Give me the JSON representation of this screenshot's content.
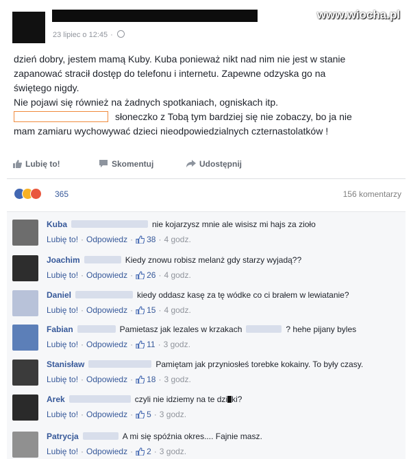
{
  "watermark": "www.wiocha.pl",
  "post": {
    "timestamp": "23 lipiec o 12:45",
    "lines": [
      "dzień dobry, jestem mamą Kuby. Kuba ponieważ nikt nad nim nie jest w stanie",
      "zapanować stracił dostęp do telefonu i internetu. Zapewne odzyska go na",
      "świętego nigdy.",
      "Nie pojawi się również na żadnych spotkaniach, ogniskach itp.",
      "słoneczko z Tobą tym bardziej się nie zobaczy, bo ja nie",
      "mam zamiaru wychowywać dzieci nieodpowiedzialnych czternastolatków !"
    ]
  },
  "actions": {
    "like": "Lubię to!",
    "comment": "Skomentuj",
    "share": "Udostępnij"
  },
  "reactions": {
    "count": "365",
    "comments": "156 komentarzy",
    "icons": [
      "like-reaction-icon",
      "haha-reaction-icon",
      "love-reaction-icon"
    ]
  },
  "comment_actions": {
    "like": "Lubię to!",
    "reply": "Odpowiedz"
  },
  "comments": [
    {
      "name": "Kuba",
      "text": "nie kojarzysz mnie ale wisisz mi hajs za zioło",
      "likes": "38",
      "time": "4 godz."
    },
    {
      "name": "Joachim",
      "text": "Kiedy znowu robisz melanż gdy starzy wyjadą??",
      "likes": "26",
      "time": "4 godz."
    },
    {
      "name": "Daniel",
      "text": "kiedy oddasz kasę za tę wódke co ci brałem w lewiatanie?",
      "likes": "15",
      "time": "4 godz."
    },
    {
      "name": "Fabian",
      "text": "Pamietasz jak lezales w krzakach",
      "text2": "? hehe pijany byles",
      "likes": "11",
      "time": "3 godz."
    },
    {
      "name": "Stanisław",
      "text": "Pamiętam jak przyniosłeś torebke kokainy. To były czasy.",
      "likes": "18",
      "time": "3 godz."
    },
    {
      "name": "Arek",
      "text": "czyli nie idziemy na te dzi",
      "text2": "ki?",
      "likes": "5",
      "time": "3 godz."
    },
    {
      "name": "Patrycja",
      "text": "A mi się spóźnia okres.... Fajnie masz.",
      "likes": "2",
      "time": "3 godz."
    }
  ]
}
